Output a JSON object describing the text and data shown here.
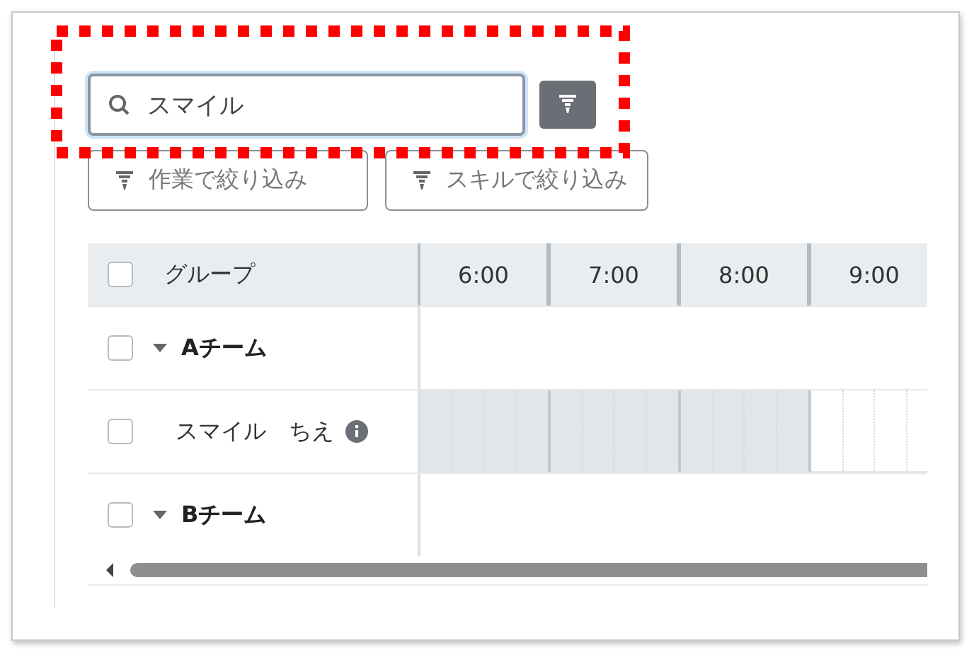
{
  "search": {
    "value": "スマイル"
  },
  "filter_buttons": [
    {
      "label": "作業で絞り込み"
    },
    {
      "label": "スキルで絞り込み"
    }
  ],
  "table": {
    "header": {
      "label": "グループ",
      "checked": false
    },
    "hours": [
      "6:00",
      "7:00",
      "8:00",
      "9:00"
    ],
    "rows": [
      {
        "kind": "group",
        "label": "Aチーム",
        "checked": false,
        "expanded": true
      },
      {
        "kind": "person",
        "label": "スマイル　ちえ",
        "checked": false,
        "busy": [
          true,
          true,
          true,
          false
        ]
      },
      {
        "kind": "group",
        "label": "Bチーム",
        "checked": false,
        "expanded": true
      }
    ]
  }
}
